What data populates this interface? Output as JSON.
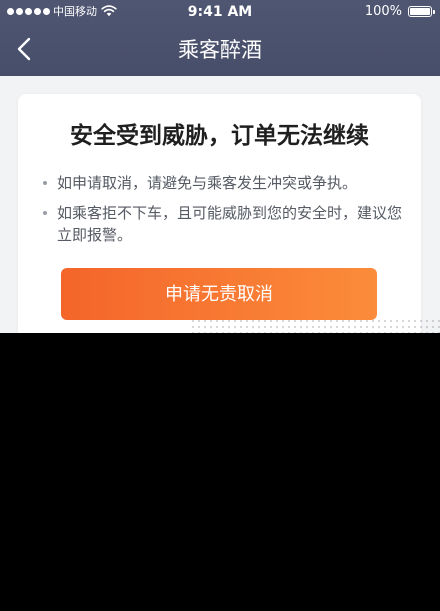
{
  "status_bar": {
    "carrier": "中国移动",
    "time": "9:41 AM",
    "battery": "100%"
  },
  "nav": {
    "title": "乘客醉酒"
  },
  "card": {
    "title": "安全受到威胁，订单无法继续",
    "bullets": [
      "如申请取消，请避免与乘客发生冲突或争执。",
      "如乘客拒不下车，且可能威胁到您的安全时，建议您立即报警。"
    ],
    "button_label": "申请无责取消"
  },
  "colors": {
    "nav_bg": "#4b526d",
    "page_bg": "#f2f3f5",
    "button_start": "#f4652a",
    "button_end": "#fb8c3b",
    "title_text": "#1f1f1f",
    "body_text": "#555a63"
  },
  "icons": {
    "back": "chevron-left-icon",
    "wifi": "wifi-icon",
    "battery": "battery-icon",
    "signal": "signal-dots-icon"
  }
}
